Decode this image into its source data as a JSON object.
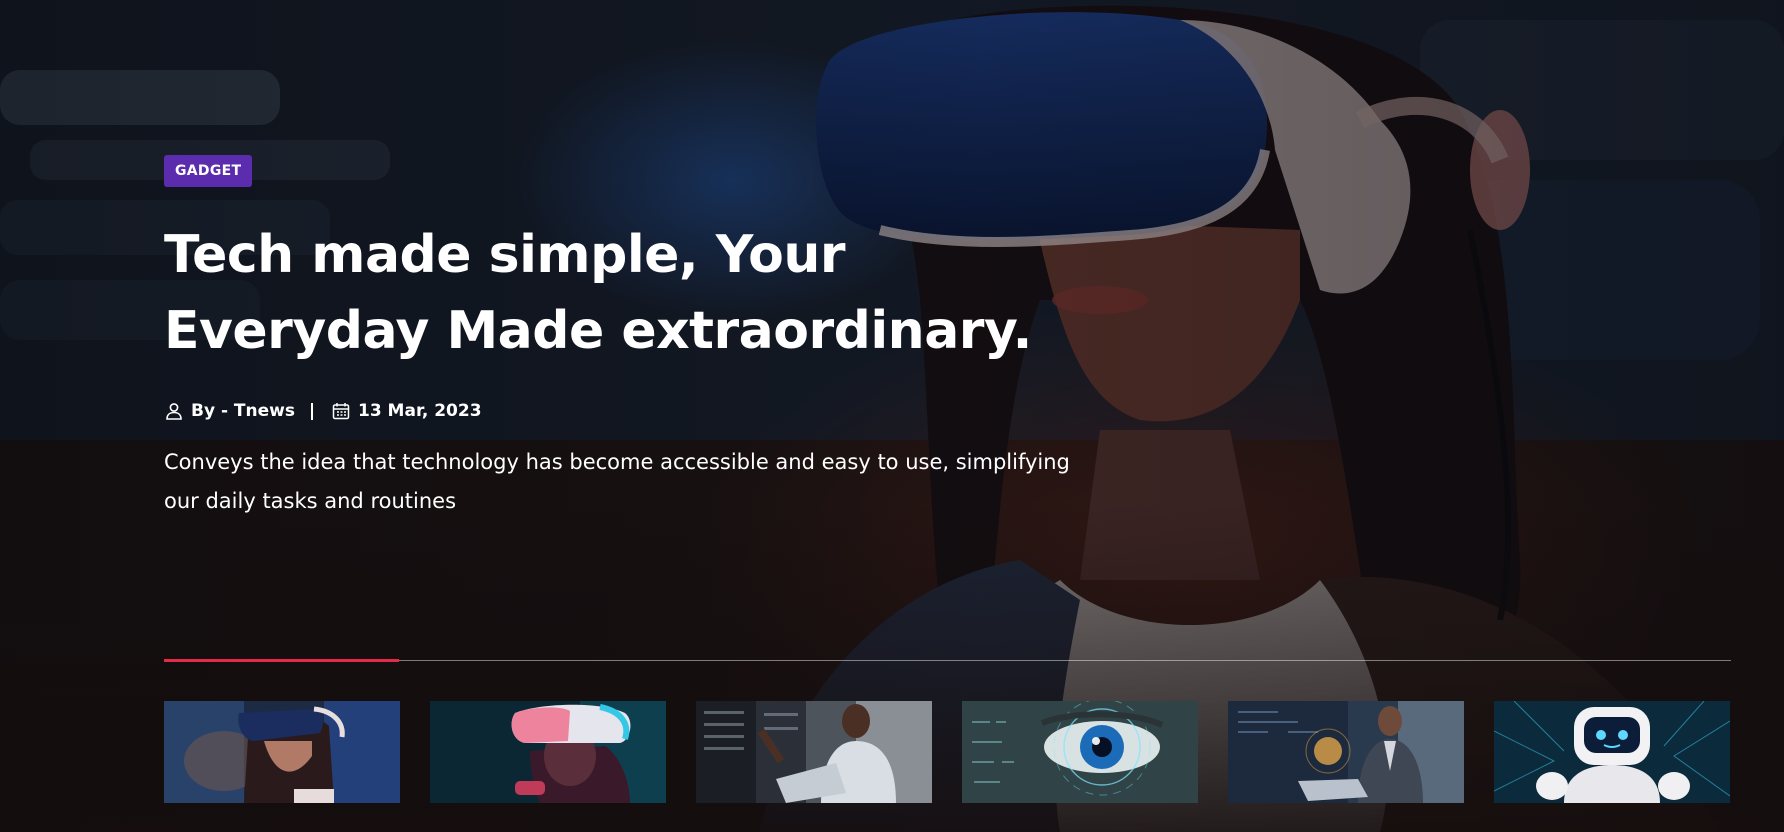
{
  "hero": {
    "category": "GADGET",
    "title": "Tech made simple, Your Everyday Made extraordinary.",
    "author": "By - Tnews",
    "date": "13 Mar, 2023",
    "excerpt": "Conveys the idea that technology has become accessible and easy to use, simplifying our daily tasks and routines",
    "progress_fraction": 0.15
  },
  "icons": {
    "author": "user-icon",
    "date": "calendar-icon"
  },
  "colors": {
    "badge": "#5b2cae",
    "progress": "#e32a49",
    "text": "#ffffff"
  },
  "thumbnails": [
    {
      "icon": "vr-woman-thumbnail"
    },
    {
      "icon": "vr-man-thumbnail"
    },
    {
      "icon": "server-engineer-thumbnail"
    },
    {
      "icon": "cyber-eye-thumbnail"
    },
    {
      "icon": "businessman-hologram-thumbnail"
    },
    {
      "icon": "robot-thumbnail"
    }
  ]
}
